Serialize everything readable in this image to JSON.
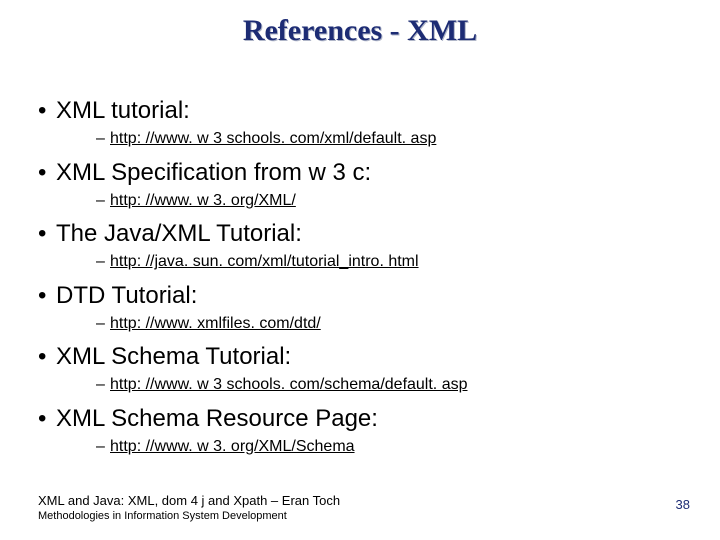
{
  "title": "References - XML",
  "items": [
    {
      "label": "XML tutorial:",
      "link": "http: //www. w 3 schools. com/xml/default. asp"
    },
    {
      "label": "XML Specification from w 3 c:",
      "link": "http: //www. w 3. org/XML/"
    },
    {
      "label": "The Java/XML Tutorial:",
      "link": "http: //java. sun. com/xml/tutorial_intro. html"
    },
    {
      "label": "DTD Tutorial:",
      "link": "http: //www. xmlfiles. com/dtd/"
    },
    {
      "label": "XML Schema Tutorial:",
      "link": "http: //www. w 3 schools. com/schema/default. asp"
    },
    {
      "label": "XML Schema Resource Page:",
      "link": "http: //www. w 3. org/XML/Schema"
    }
  ],
  "footer": {
    "line1": "XML and Java: XML, dom 4 j and Xpath – Eran Toch",
    "line2": "Methodologies in Information System Development"
  },
  "page_number": "38"
}
